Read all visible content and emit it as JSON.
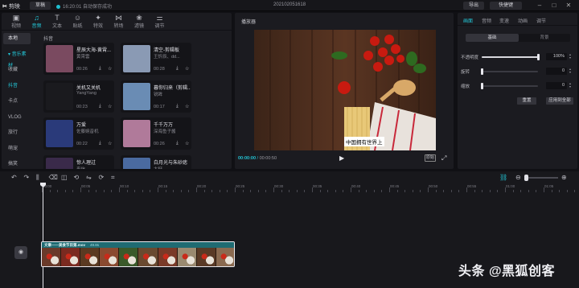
{
  "app": {
    "logo_label": "剪映",
    "draft_button": "草稿",
    "save_status": "16:20:01 自动保存成功",
    "project_title": "202102051618",
    "export_button": "导出",
    "shortcut_button": "快捷键",
    "window_controls": [
      "minimize-icon",
      "maximize-icon",
      "close-icon"
    ]
  },
  "media_panel": {
    "tabs": [
      {
        "label": "视频",
        "icon": "video-icon",
        "active": false
      },
      {
        "label": "音频",
        "icon": "music-note-icon",
        "active": true
      },
      {
        "label": "文本",
        "icon": "text-icon",
        "active": false
      },
      {
        "label": "贴纸",
        "icon": "sticker-icon",
        "active": false
      },
      {
        "label": "特效",
        "icon": "sparkle-icon",
        "active": false
      },
      {
        "label": "转场",
        "icon": "transition-icon",
        "active": false
      },
      {
        "label": "滤镜",
        "icon": "filter-icon",
        "active": false
      },
      {
        "label": "调节",
        "icon": "adjust-icon",
        "active": false
      }
    ],
    "categories": [
      {
        "label": "本地",
        "selected": true,
        "highlight": false
      },
      {
        "label": "▾ 音乐素材",
        "selected": false,
        "highlight": true
      },
      {
        "label": "收藏",
        "selected": false,
        "highlight": false
      },
      {
        "label": "抖音",
        "selected": false,
        "highlight": true
      },
      {
        "label": "卡点",
        "selected": false,
        "highlight": false
      },
      {
        "label": "VLOG",
        "selected": false,
        "highlight": false
      },
      {
        "label": "旅行",
        "selected": false,
        "highlight": false
      },
      {
        "label": "萌宠",
        "selected": false,
        "highlight": false
      },
      {
        "label": "搞笑",
        "selected": false,
        "highlight": false
      }
    ],
    "section_label": "抖音",
    "music_items": [
      {
        "title": "星辰大海-黄霄...",
        "artist": "黄霄雲",
        "duration": "00:26",
        "thumb_color": "#7a4a60"
      },
      {
        "title": "清空-剪辑板",
        "artist": "王忻辰、dd...",
        "duration": "00:28",
        "thumb_color": "#8a9ab4"
      },
      {
        "title": "关机又关机",
        "artist": "YangYang",
        "duration": "00:23",
        "thumb_color": "#1a1a1e"
      },
      {
        "title": "暮你归来（剪辑...",
        "artist": "锐眸",
        "duration": "00:17",
        "thumb_color": "#6a8cb4"
      },
      {
        "title": "万爱",
        "artist": "佐藤婉音机",
        "duration": "00:22",
        "thumb_color": "#2a3a7a"
      },
      {
        "title": "千千万万",
        "artist": "深海鱼子酱",
        "duration": "00:26",
        "thumb_color": "#b07a9a"
      },
      {
        "title": "惊人理过",
        "artist": "来信",
        "duration": "",
        "thumb_color": "#3a2a4a"
      },
      {
        "title": "白月光与朱砂痣",
        "artist": "大籽",
        "duration": "",
        "thumb_color": "#4a6aa0"
      }
    ],
    "item_icons": [
      "download-icon",
      "star-icon"
    ]
  },
  "player": {
    "title": "播放器",
    "subtitle_text": "中国拥有世界上",
    "time_current": "00:00:00",
    "time_total": "00:00:50",
    "ratio_button": "原始"
  },
  "inspector": {
    "tabs": [
      {
        "label": "画面",
        "active": true
      },
      {
        "label": "音频",
        "active": false
      },
      {
        "label": "变速",
        "active": false
      },
      {
        "label": "动画",
        "active": false
      },
      {
        "label": "调节",
        "active": false
      }
    ],
    "segment_basic": "基础",
    "segment_background": "背景",
    "properties": [
      {
        "label": "不透明度",
        "value": "100%",
        "level": 1.0
      },
      {
        "label": "旋转",
        "value": "0",
        "level": 0.0
      },
      {
        "label": "缩放",
        "value": "0",
        "level": 0.0
      }
    ],
    "reset_button": "重置",
    "apply_all_button": "应用到全部"
  },
  "timeline": {
    "toolbar_icons": [
      "undo-icon",
      "redo-icon",
      "split-icon",
      "delete-icon",
      "freeze-icon",
      "reverse-icon",
      "mirror-icon",
      "rotate-icon",
      "crop-icon"
    ],
    "right_icons": [
      "link-icon",
      "zoom-out-icon",
      "zoom-in-icon"
    ],
    "ruler_labels": [
      "00:00",
      "00:05",
      "00:10",
      "00:15",
      "00:20",
      "00:25",
      "00:30",
      "00:35",
      "00:40",
      "00:45",
      "00:50",
      "00:55",
      "01:00",
      "01:05"
    ],
    "clip_title": "文章——美食节目第.mov",
    "clip_duration": "49.8s",
    "frame_colors": [
      "#6a3a2a",
      "#7a2a20",
      "#5a3a22",
      "#8a4a30",
      "#3a5a2a",
      "#6a4a30",
      "#7a3a28",
      "#9a8a70",
      "#5a3a26",
      "#8a6a50"
    ]
  },
  "watermark": "头条 @黑狐创客"
}
